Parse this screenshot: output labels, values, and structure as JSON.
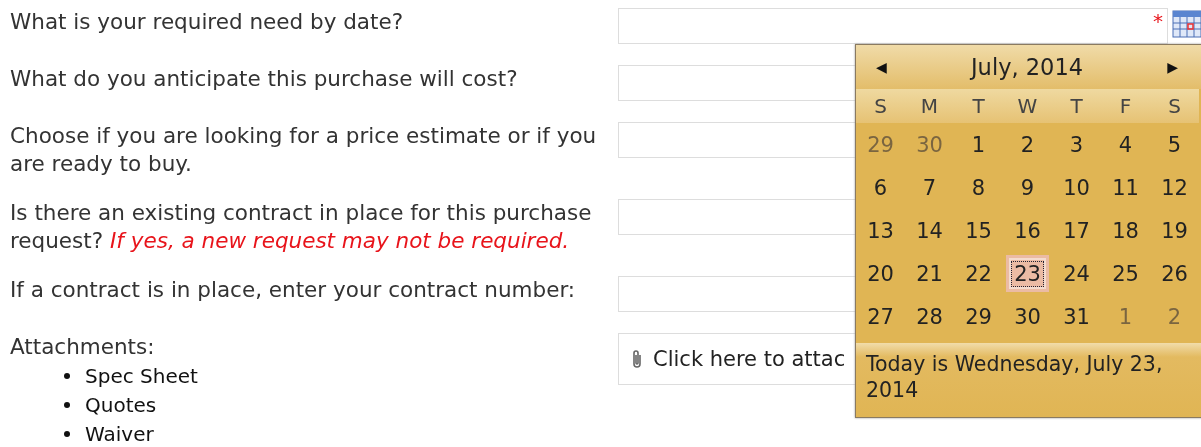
{
  "questions": [
    {
      "kind": "date",
      "label": "What is your required need by date?",
      "required_mark": "*"
    },
    {
      "kind": "text",
      "label": "What do you anticipate this purchase will cost?"
    },
    {
      "kind": "text",
      "label": "Choose if you are looking for a price estimate or if you are ready to buy."
    },
    {
      "kind": "text",
      "label": "Is there an existing contract in place for this purchase request? *If yes, a new request may not be required.*"
    },
    {
      "kind": "text",
      "label": "If a contract is in place, enter your contract number:"
    },
    {
      "kind": "attachments",
      "label": "Attachments:",
      "items": [
        "Spec Sheet",
        "Quotes",
        "Waiver"
      ],
      "button": "Click here to attac"
    }
  ],
  "calendar": {
    "title": "July, 2014",
    "prev": "◀",
    "next": "▶",
    "weekdays": [
      "S",
      "M",
      "T",
      "W",
      "T",
      "F",
      "S"
    ],
    "weeks": [
      [
        {
          "day": "29",
          "other_month": true,
          "selected": false
        },
        {
          "day": "30",
          "other_month": true,
          "selected": false
        },
        {
          "day": "1",
          "other_month": false,
          "selected": false
        },
        {
          "day": "2",
          "other_month": false,
          "selected": false
        },
        {
          "day": "3",
          "other_month": false,
          "selected": false
        },
        {
          "day": "4",
          "other_month": false,
          "selected": false
        },
        {
          "day": "5",
          "other_month": false,
          "selected": false
        }
      ],
      [
        {
          "day": "6",
          "other_month": false,
          "selected": false
        },
        {
          "day": "7",
          "other_month": false,
          "selected": false
        },
        {
          "day": "8",
          "other_month": false,
          "selected": false
        },
        {
          "day": "9",
          "other_month": false,
          "selected": false
        },
        {
          "day": "10",
          "other_month": false,
          "selected": false
        },
        {
          "day": "11",
          "other_month": false,
          "selected": false
        },
        {
          "day": "12",
          "other_month": false,
          "selected": false
        }
      ],
      [
        {
          "day": "13",
          "other_month": false,
          "selected": false
        },
        {
          "day": "14",
          "other_month": false,
          "selected": false
        },
        {
          "day": "15",
          "other_month": false,
          "selected": false
        },
        {
          "day": "16",
          "other_month": false,
          "selected": false
        },
        {
          "day": "17",
          "other_month": false,
          "selected": false
        },
        {
          "day": "18",
          "other_month": false,
          "selected": false
        },
        {
          "day": "19",
          "other_month": false,
          "selected": false
        }
      ],
      [
        {
          "day": "20",
          "other_month": false,
          "selected": false
        },
        {
          "day": "21",
          "other_month": false,
          "selected": false
        },
        {
          "day": "22",
          "other_month": false,
          "selected": false
        },
        {
          "day": "23",
          "other_month": false,
          "selected": true
        },
        {
          "day": "24",
          "other_month": false,
          "selected": false
        },
        {
          "day": "25",
          "other_month": false,
          "selected": false
        },
        {
          "day": "26",
          "other_month": false,
          "selected": false
        }
      ],
      [
        {
          "day": "27",
          "other_month": false,
          "selected": false
        },
        {
          "day": "28",
          "other_month": false,
          "selected": false
        },
        {
          "day": "29",
          "other_month": false,
          "selected": false
        },
        {
          "day": "30",
          "other_month": false,
          "selected": false
        },
        {
          "day": "31",
          "other_month": false,
          "selected": false
        },
        {
          "day": "1",
          "other_month": true,
          "selected": false
        },
        {
          "day": "2",
          "other_month": true,
          "selected": false
        }
      ]
    ],
    "today_text": "Today is Wednesday, July 23, 2014"
  }
}
